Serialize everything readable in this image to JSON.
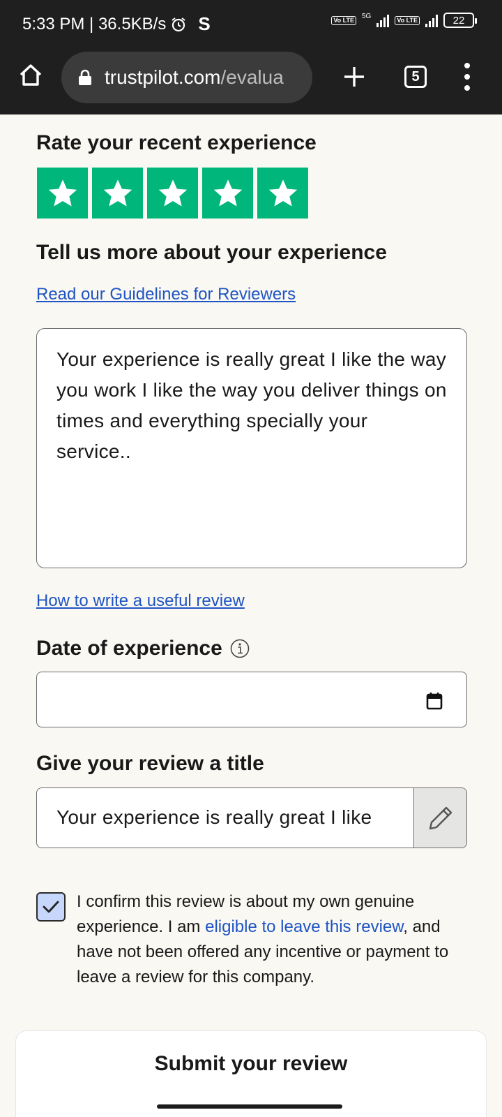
{
  "status_bar": {
    "time_speed": "5:33 PM | 36.5KB/s",
    "app_glyph": "S",
    "network_generation": "5G",
    "volte_label": "Vo LTE",
    "battery": "22",
    "icons": [
      "alarm-icon",
      "signal-icon",
      "battery-icon"
    ]
  },
  "browser": {
    "url_main": "trustpilot.com",
    "url_path": "/evalua",
    "tab_count": "5",
    "icons": [
      "home-icon",
      "lock-icon",
      "plus-icon",
      "tabs-icon",
      "more-vert-icon"
    ]
  },
  "rating": {
    "heading": "Rate your recent experience",
    "stars_filled": 5,
    "stars_total": 5,
    "star_color": "#00b67a"
  },
  "experience": {
    "heading": "Tell us more about your experience",
    "guidelines_link": "Read our Guidelines for Reviewers",
    "review_text": "Your experience is really great I like the way you work I like the way you deliver things on times and everything specially your service..",
    "how_to_link": "How to write a useful review"
  },
  "date": {
    "heading": "Date of experience",
    "value": "",
    "icons": [
      "info-icon",
      "calendar-icon"
    ]
  },
  "title": {
    "heading": "Give your review a title",
    "value": "Your experience is really great I like",
    "icons": [
      "pencil-icon"
    ]
  },
  "confirm": {
    "checked": true,
    "text_before": "I confirm this review is about my own genuine experience. I am ",
    "link": "eligible to leave this review",
    "text_after": ", and have not been offered any incentive or payment to leave a review for this company."
  },
  "submit": {
    "label": "Submit your review"
  },
  "colors": {
    "link": "#1f54c4",
    "checkbox_fill": "#c6d7fb",
    "browser_bar": "#1f1f1f",
    "page_bg": "#f9f8f3"
  }
}
